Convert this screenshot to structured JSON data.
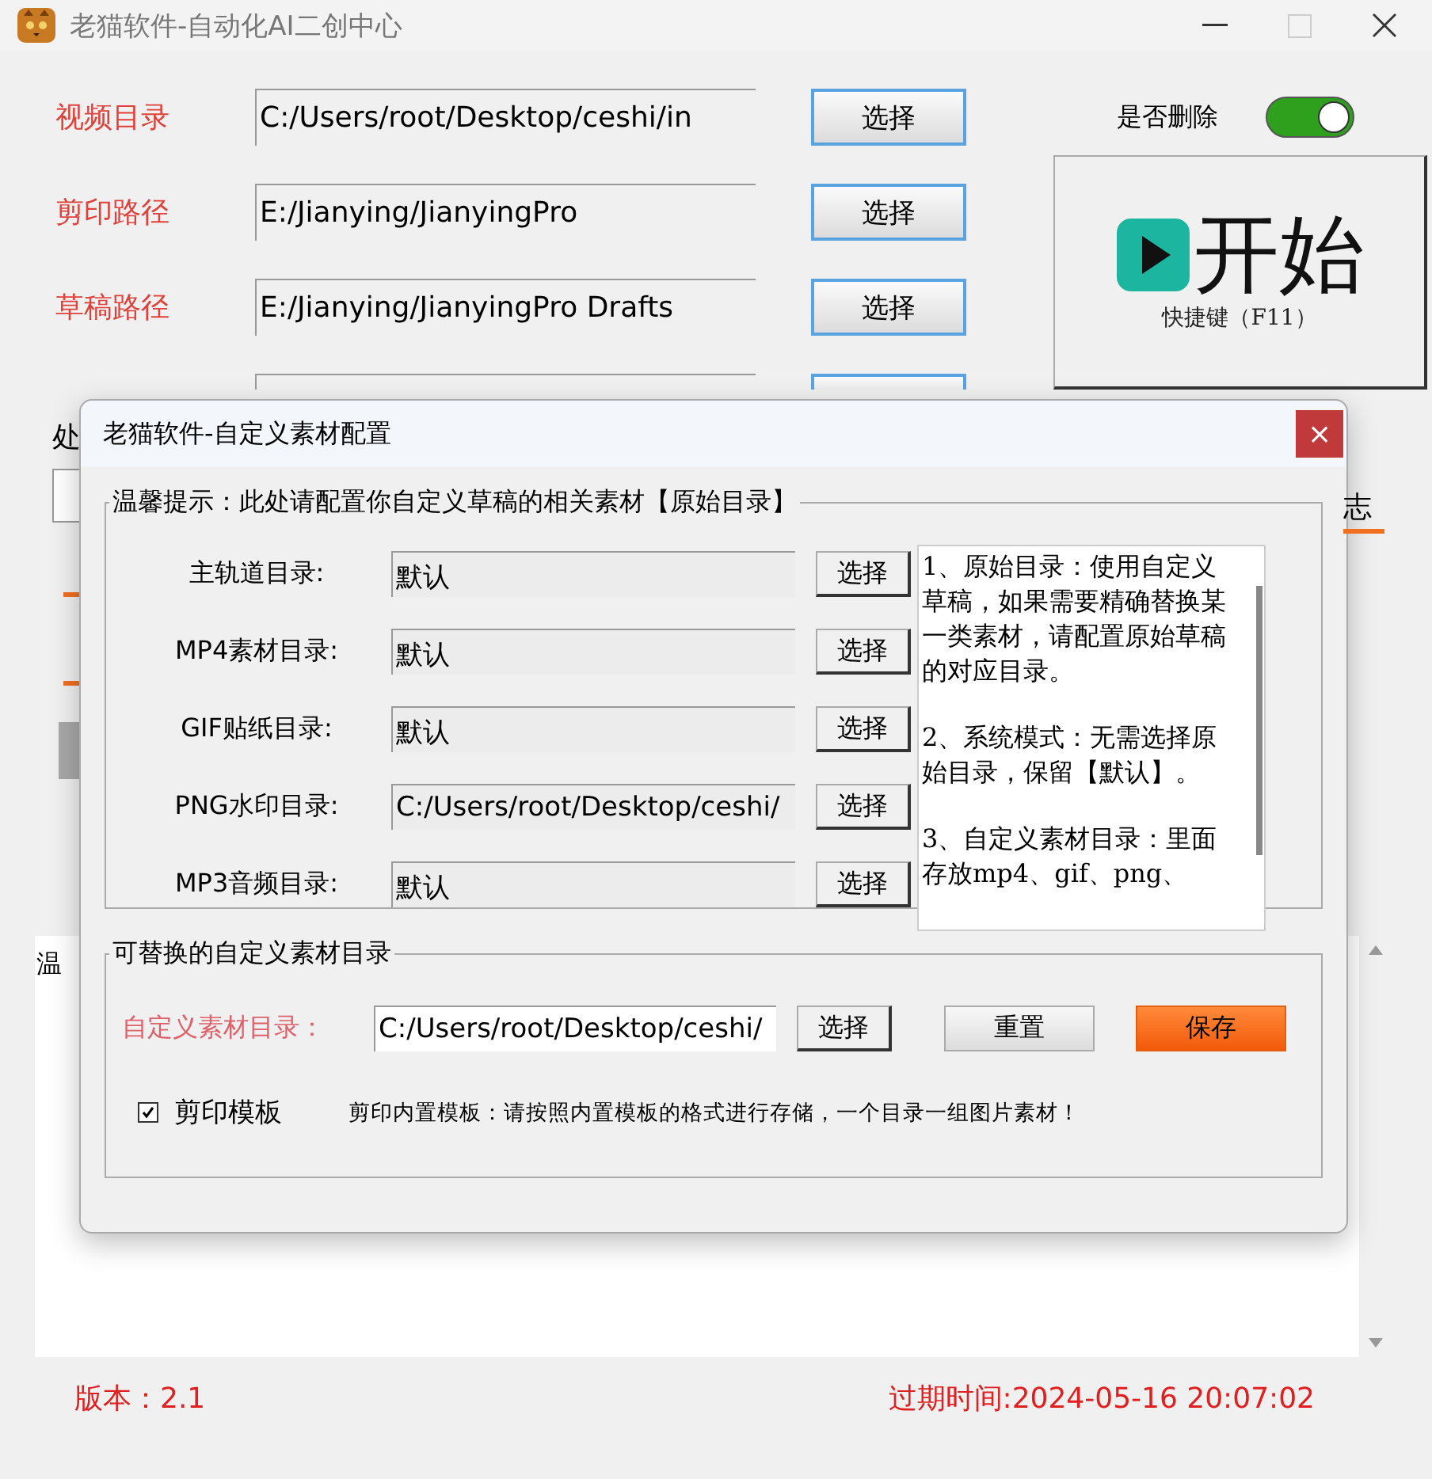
{
  "window": {
    "title": "老猫软件-自动化AI二创中心"
  },
  "paths": [
    {
      "label": "视频目录",
      "value": "C:/Users/root/Desktop/ceshi/in",
      "button": "选择",
      "kind": "full"
    },
    {
      "label": "剪印路径",
      "value": "E:/Jianying/JianyingPro",
      "button": "选择",
      "kind": "full"
    },
    {
      "label": "草稿路径",
      "value": "E:/Jianying/JianyingPro Drafts",
      "button": "选择",
      "kind": "full"
    },
    {
      "kind": "partial"
    }
  ],
  "delete_toggle": {
    "label": "是否删除",
    "on": true
  },
  "start_button": {
    "label": "开始",
    "shortcut": "快捷键（F11）"
  },
  "side_panel": {
    "group_title": "处"
  },
  "log": {
    "tab": "志",
    "text": "温"
  },
  "footer": {
    "version": "版本：2.1",
    "expiry": "过期时间:2024-05-16 20:07:02"
  },
  "dialog": {
    "title": "老猫软件-自定义素材配置",
    "close": "×",
    "original": {
      "title": "温馨提示：此处请配置你自定义草稿的相关素材【原始目录】",
      "rows": [
        {
          "label": "主轨道目录:",
          "value": "默认",
          "button": "选择"
        },
        {
          "label": "MP4素材目录:",
          "value": "默认",
          "button": "选择"
        },
        {
          "label": "GIF贴纸目录:",
          "value": "默认",
          "button": "选择"
        },
        {
          "label": "PNG水印目录:",
          "value": "C:/Users/root/Desktop/ceshi/",
          "button": "选择"
        },
        {
          "label": "MP3音频目录:",
          "value": "默认",
          "button": "选择"
        }
      ],
      "help": [
        "1、原始目录：使用自定义草稿，如果需要精确替换某一类素材，请配置原始草稿的对应目录。",
        "2、系统模式：无需选择原始目录，保留【默认】。",
        "3、自定义素材目录：里面存放mp4、gif、png、"
      ]
    },
    "custom": {
      "title": "可替换的自定义素材目录",
      "label": "自定义素材目录：",
      "value": "C:/Users/root/Desktop/ceshi/",
      "buttons": [
        {
          "label": "选择",
          "kind": "select"
        },
        {
          "label": "重置",
          "kind": "reset"
        },
        {
          "label": "保存",
          "kind": "save"
        }
      ],
      "template": {
        "label": "剪印模板",
        "checked": true
      },
      "note": "剪印内置模板：请按照内置模板的格式进行存储，一个目录一组图片素材！"
    }
  }
}
